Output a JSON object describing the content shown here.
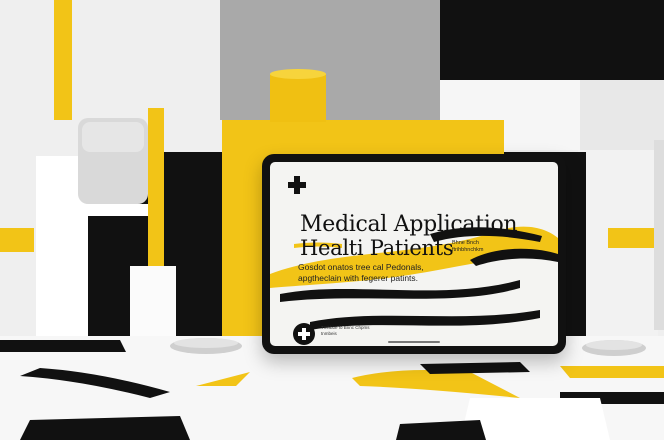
{
  "colors": {
    "accent": "#f2c417",
    "dark": "#111111",
    "light": "#f4f4f2"
  },
  "tablet": {
    "icon": "plus-cross-icon",
    "title_line1": "Medical Application",
    "title_line2": "Healti Patients",
    "side_note": "Bhne Bnch ftrihbhnchkm",
    "body_text": "Gosdot onatos tree cal Pedonals, apgtheclain with fegerer patints.",
    "footer_icon": "plus-circle-icon",
    "footer_text": "Tmhbbe fo Bnnc Chpms tnmbeis"
  }
}
